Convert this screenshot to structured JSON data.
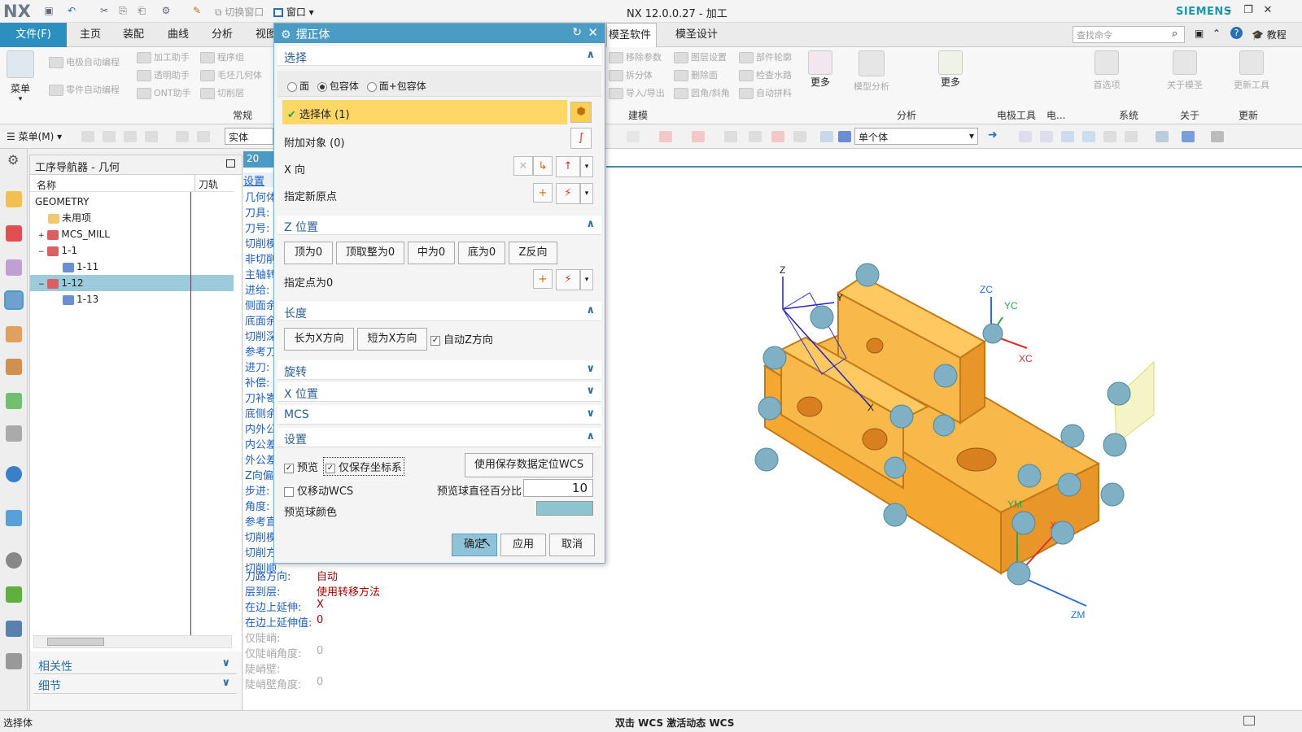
{
  "app": {
    "logo": "NX",
    "title": "NX 12.0.0.27 - 加工",
    "brand": "SIEMENS"
  },
  "quick_access": {
    "switch_window": "切换窗口",
    "window": "窗口"
  },
  "menubar": {
    "file": "文件(F)",
    "tabs": [
      "主页",
      "装配",
      "曲线",
      "分析",
      "视图"
    ],
    "right_tabs": [
      "模圣软件",
      "模圣设计"
    ],
    "search_placeholder": "查找命令",
    "tutorial": "教程"
  },
  "ribbon": {
    "menu_label": "菜单",
    "left_items": [
      "电极自动编程",
      "零件自动编程",
      "加工助手",
      "透明助手",
      "ONT助手",
      "程序组",
      "毛坯几何体",
      "切削层"
    ],
    "group_common": "常规",
    "model_items": [
      "移除参数",
      "拆分体",
      "导入/导出",
      "图层设置",
      "删除面",
      "圆角/斜角",
      "部件轮廓",
      "检查水路",
      "自动拼料"
    ],
    "more": "更多",
    "group_model": "建模",
    "analysis_item": "模型分析",
    "group_analysis": "分析",
    "group_electrode": "电极工具",
    "group_elec2": "电...",
    "pref_item": "首选项",
    "group_system": "系统",
    "about_item": "关于模圣",
    "group_about": "关于",
    "update_item": "更新工具",
    "group_update": "更新"
  },
  "toolbar2": {
    "menu": "菜单(M)",
    "filter": "实体",
    "select_scope": "单个体"
  },
  "nav": {
    "title": "工序导航器 - 几何",
    "col_name": "名称",
    "col_path": "刀轨",
    "items": [
      {
        "label": "GEOMETRY",
        "indent": 0,
        "icon": "none"
      },
      {
        "label": "未用项",
        "indent": 1,
        "icon": "folder"
      },
      {
        "label": "MCS_MILL",
        "indent": 1,
        "icon": "mcs"
      },
      {
        "label": "1-1",
        "indent": 1,
        "icon": "mcs"
      },
      {
        "label": "1-11",
        "indent": 2,
        "icon": "body"
      },
      {
        "label": "1-12",
        "indent": 1,
        "icon": "mcs",
        "selected": true
      },
      {
        "label": "1-13",
        "indent": 2,
        "icon": "body"
      }
    ],
    "related": "相关性",
    "details": "细节"
  },
  "op_panel": {
    "tab_num": "20",
    "setting_tab": "设置",
    "labels": [
      "几何体",
      "刀具:",
      "刀号:",
      "切削模",
      "非切削",
      "主轴转",
      "进给:",
      "侧面余",
      "底面余",
      "切削深",
      "参考刀",
      "进刀:",
      "补偿:",
      "刀补寄",
      "底侧余",
      "内外公",
      "内公差",
      "外公差",
      "Z向偏",
      "步进:",
      "角度:",
      "参考直",
      "切削模",
      "切削方",
      "切削顺"
    ],
    "rows": [
      {
        "label": "刀路方向:",
        "value": "自动"
      },
      {
        "label": "层到层:",
        "value": "使用转移方法"
      },
      {
        "label": "在边上延伸:",
        "value": "X"
      },
      {
        "label": "在边上延伸值:",
        "value": "0"
      },
      {
        "label": "仅陡峭:",
        "value": ""
      },
      {
        "label": "仅陡峭角度:",
        "value": "0"
      },
      {
        "label": "陡峭壁:",
        "value": ""
      },
      {
        "label": "陡峭壁角度:",
        "value": "0"
      }
    ]
  },
  "dialog": {
    "title": "摆正体",
    "sec_select": "选择",
    "radio_face": "面",
    "radio_bbox": "包容体",
    "radio_face_bbox": "面+包容体",
    "select_body": "选择体 (1)",
    "extra_objects": "附加对象 (0)",
    "x_dir": "X 向",
    "new_origin": "指定新原点",
    "sec_z": "Z 位置",
    "z_buttons": [
      "顶为0",
      "顶取整为0",
      "中为0",
      "底为0",
      "Z反向"
    ],
    "point_zero": "指定点为0",
    "sec_length": "长度",
    "len_buttons": [
      "长为X方向",
      "短为X方向"
    ],
    "auto_z": "自动Z方向",
    "sec_rotate": "旋转",
    "sec_xpos": "X 位置",
    "sec_mcs": "MCS",
    "sec_settings": "设置",
    "preview": "预览",
    "save_cs_only": "仅保存坐标系",
    "use_saved_btn": "使用保存数据定位WCS",
    "move_wcs_only": "仅移动WCS",
    "ball_pct_label": "预览球直径百分比",
    "ball_pct_value": "10",
    "ball_color_label": "预览球颜色",
    "ball_color": "#8ec3d2",
    "ok": "确定",
    "apply": "应用",
    "cancel": "取消"
  },
  "viewport": {
    "axis_labels": {
      "z": "Z",
      "y": "Y",
      "x": "X",
      "zc": "ZC",
      "yc": "YC",
      "xc": "XC",
      "ym": "YM",
      "xm": "XM",
      "zm": "ZM"
    },
    "body_color": "#f8b84a",
    "ball_color": "#7fb0c4"
  },
  "status": {
    "left": "选择体",
    "center": "双击 WCS 激活动态 WCS"
  }
}
